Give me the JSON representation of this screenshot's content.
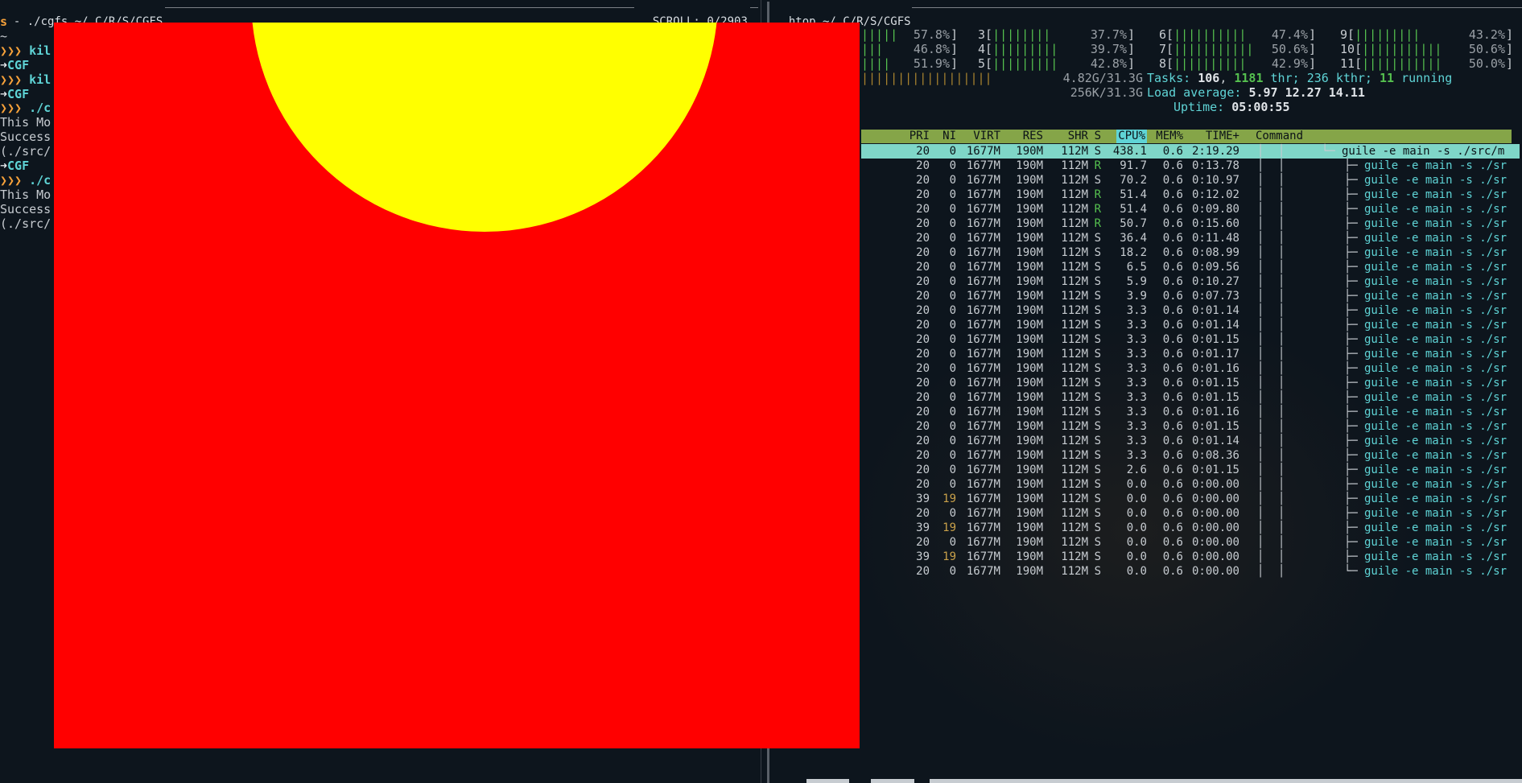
{
  "left_title": {
    "path": "./cgfs ~/.C/R/S/CGFS",
    "scroll_label": "SCROLL:",
    "scroll_value": "0/2903"
  },
  "right_title": {
    "path": "htop ~/.C/R/S/CGFS"
  },
  "terminal_lines": [
    {
      "kind": "s",
      "text": "s"
    },
    {
      "kind": "blank",
      "text": "~"
    },
    {
      "kind": "cmd",
      "prompt": "❯❯❯",
      "text": "kil"
    },
    {
      "kind": "git",
      "prompt": "➜",
      "text": "CGF"
    },
    {
      "kind": "cmd",
      "prompt": "❯❯❯",
      "text": "kil"
    },
    {
      "kind": "git",
      "prompt": "➜",
      "text": "CGF"
    },
    {
      "kind": "cmd",
      "prompt": "❯❯❯",
      "text": "./c"
    },
    {
      "kind": "out",
      "text": "This Mo"
    },
    {
      "kind": "out",
      "text": "Success"
    },
    {
      "kind": "out",
      "text": "(./src/"
    },
    {
      "kind": "git",
      "prompt": "➜",
      "text": "CGF"
    },
    {
      "kind": "cmd",
      "prompt": "❯❯❯",
      "text": "./c"
    },
    {
      "kind": "out",
      "text": "This Mo"
    },
    {
      "kind": "out",
      "text": "Success"
    },
    {
      "kind": "out",
      "text": "(./src/"
    }
  ],
  "cpu_meters": [
    {
      "col": 0,
      "row": 0,
      "label": "",
      "bar": "|||||",
      "value": "57.8%"
    },
    {
      "col": 0,
      "row": 1,
      "label": "",
      "bar": "|||",
      "value": "46.8%"
    },
    {
      "col": 0,
      "row": 2,
      "label": "",
      "bar": "||||",
      "value": "51.9%"
    },
    {
      "col": 1,
      "row": 0,
      "label": "3",
      "bar": "||||||||",
      "value": "37.7%"
    },
    {
      "col": 1,
      "row": 1,
      "label": "4",
      "bar": "|||||||||",
      "value": "39.7%"
    },
    {
      "col": 1,
      "row": 2,
      "label": "5",
      "bar": "|||||||||",
      "value": "42.8%"
    },
    {
      "col": 2,
      "row": 0,
      "label": "6",
      "bar": "||||||||||",
      "value": "47.4%"
    },
    {
      "col": 2,
      "row": 1,
      "label": "7",
      "bar": "|||||||||||",
      "value": "50.6%"
    },
    {
      "col": 2,
      "row": 2,
      "label": "8",
      "bar": "||||||||||",
      "value": "42.9%"
    },
    {
      "col": 3,
      "row": 0,
      "label": "9",
      "bar": "|||||||||",
      "value": "43.2%"
    },
    {
      "col": 3,
      "row": 1,
      "label": "10",
      "bar": "|||||||||||",
      "value": "50.6%"
    },
    {
      "col": 3,
      "row": 2,
      "label": "11",
      "bar": "|||||||||||",
      "value": "50.0%"
    }
  ],
  "mem": {
    "bar": "||||||||||||||||||",
    "value": "4.82G/31.3G"
  },
  "swap": {
    "value": "256K/31.3G"
  },
  "tasks": {
    "label": "Tasks:",
    "count": "106",
    "thr": "1181",
    "thr_label": "thr;",
    "kthr": "236",
    "kthr_label": "kthr;",
    "running": "11",
    "running_label": "running"
  },
  "load": {
    "label": "Load average:",
    "v1": "5.97",
    "v5": "12.27",
    "v15": "14.11"
  },
  "uptime": {
    "label": "Uptime:",
    "value": "05:00:55"
  },
  "columns": [
    "PRI",
    "NI",
    "VIRT",
    "RES",
    "SHR",
    "S",
    "CPU%",
    "MEM%",
    "TIME+",
    "Command"
  ],
  "processes": [
    {
      "pri": "20",
      "ni": "0",
      "virt": "1677M",
      "res": "190M",
      "shr": "112M",
      "s": "S",
      "cpu": "438.1",
      "mem": "0.6",
      "time": "2:19.29",
      "tree": "└─",
      "cmd": "guile -e main -s ./src/m"
    },
    {
      "pri": "20",
      "ni": "0",
      "virt": "1677M",
      "res": "190M",
      "shr": "112M",
      "s": "R",
      "cpu": "91.7",
      "mem": "0.6",
      "time": "0:13.78",
      "tree": "├─",
      "cmd": "guile -e main -s ./sr"
    },
    {
      "pri": "20",
      "ni": "0",
      "virt": "1677M",
      "res": "190M",
      "shr": "112M",
      "s": "S",
      "cpu": "70.2",
      "mem": "0.6",
      "time": "0:10.97",
      "tree": "├─",
      "cmd": "guile -e main -s ./sr"
    },
    {
      "pri": "20",
      "ni": "0",
      "virt": "1677M",
      "res": "190M",
      "shr": "112M",
      "s": "R",
      "cpu": "51.4",
      "mem": "0.6",
      "time": "0:12.02",
      "tree": "├─",
      "cmd": "guile -e main -s ./sr"
    },
    {
      "pri": "20",
      "ni": "0",
      "virt": "1677M",
      "res": "190M",
      "shr": "112M",
      "s": "R",
      "cpu": "51.4",
      "mem": "0.6",
      "time": "0:09.80",
      "tree": "├─",
      "cmd": "guile -e main -s ./sr"
    },
    {
      "pri": "20",
      "ni": "0",
      "virt": "1677M",
      "res": "190M",
      "shr": "112M",
      "s": "R",
      "cpu": "50.7",
      "mem": "0.6",
      "time": "0:15.60",
      "tree": "├─",
      "cmd": "guile -e main -s ./sr"
    },
    {
      "pri": "20",
      "ni": "0",
      "virt": "1677M",
      "res": "190M",
      "shr": "112M",
      "s": "S",
      "cpu": "36.4",
      "mem": "0.6",
      "time": "0:11.48",
      "tree": "├─",
      "cmd": "guile -e main -s ./sr"
    },
    {
      "pri": "20",
      "ni": "0",
      "virt": "1677M",
      "res": "190M",
      "shr": "112M",
      "s": "S",
      "cpu": "18.2",
      "mem": "0.6",
      "time": "0:08.99",
      "tree": "├─",
      "cmd": "guile -e main -s ./sr"
    },
    {
      "pri": "20",
      "ni": "0",
      "virt": "1677M",
      "res": "190M",
      "shr": "112M",
      "s": "S",
      "cpu": "6.5",
      "mem": "0.6",
      "time": "0:09.56",
      "tree": "├─",
      "cmd": "guile -e main -s ./sr"
    },
    {
      "pri": "20",
      "ni": "0",
      "virt": "1677M",
      "res": "190M",
      "shr": "112M",
      "s": "S",
      "cpu": "5.9",
      "mem": "0.6",
      "time": "0:10.27",
      "tree": "├─",
      "cmd": "guile -e main -s ./sr"
    },
    {
      "pri": "20",
      "ni": "0",
      "virt": "1677M",
      "res": "190M",
      "shr": "112M",
      "s": "S",
      "cpu": "3.9",
      "mem": "0.6",
      "time": "0:07.73",
      "tree": "├─",
      "cmd": "guile -e main -s ./sr"
    },
    {
      "pri": "20",
      "ni": "0",
      "virt": "1677M",
      "res": "190M",
      "shr": "112M",
      "s": "S",
      "cpu": "3.3",
      "mem": "0.6",
      "time": "0:01.14",
      "tree": "├─",
      "cmd": "guile -e main -s ./sr"
    },
    {
      "pri": "20",
      "ni": "0",
      "virt": "1677M",
      "res": "190M",
      "shr": "112M",
      "s": "S",
      "cpu": "3.3",
      "mem": "0.6",
      "time": "0:01.14",
      "tree": "├─",
      "cmd": "guile -e main -s ./sr"
    },
    {
      "pri": "20",
      "ni": "0",
      "virt": "1677M",
      "res": "190M",
      "shr": "112M",
      "s": "S",
      "cpu": "3.3",
      "mem": "0.6",
      "time": "0:01.15",
      "tree": "├─",
      "cmd": "guile -e main -s ./sr"
    },
    {
      "pri": "20",
      "ni": "0",
      "virt": "1677M",
      "res": "190M",
      "shr": "112M",
      "s": "S",
      "cpu": "3.3",
      "mem": "0.6",
      "time": "0:01.17",
      "tree": "├─",
      "cmd": "guile -e main -s ./sr"
    },
    {
      "pri": "20",
      "ni": "0",
      "virt": "1677M",
      "res": "190M",
      "shr": "112M",
      "s": "S",
      "cpu": "3.3",
      "mem": "0.6",
      "time": "0:01.16",
      "tree": "├─",
      "cmd": "guile -e main -s ./sr"
    },
    {
      "pri": "20",
      "ni": "0",
      "virt": "1677M",
      "res": "190M",
      "shr": "112M",
      "s": "S",
      "cpu": "3.3",
      "mem": "0.6",
      "time": "0:01.15",
      "tree": "├─",
      "cmd": "guile -e main -s ./sr"
    },
    {
      "pri": "20",
      "ni": "0",
      "virt": "1677M",
      "res": "190M",
      "shr": "112M",
      "s": "S",
      "cpu": "3.3",
      "mem": "0.6",
      "time": "0:01.15",
      "tree": "├─",
      "cmd": "guile -e main -s ./sr"
    },
    {
      "pri": "20",
      "ni": "0",
      "virt": "1677M",
      "res": "190M",
      "shr": "112M",
      "s": "S",
      "cpu": "3.3",
      "mem": "0.6",
      "time": "0:01.16",
      "tree": "├─",
      "cmd": "guile -e main -s ./sr"
    },
    {
      "pri": "20",
      "ni": "0",
      "virt": "1677M",
      "res": "190M",
      "shr": "112M",
      "s": "S",
      "cpu": "3.3",
      "mem": "0.6",
      "time": "0:01.15",
      "tree": "├─",
      "cmd": "guile -e main -s ./sr"
    },
    {
      "pri": "20",
      "ni": "0",
      "virt": "1677M",
      "res": "190M",
      "shr": "112M",
      "s": "S",
      "cpu": "3.3",
      "mem": "0.6",
      "time": "0:01.14",
      "tree": "├─",
      "cmd": "guile -e main -s ./sr"
    },
    {
      "pri": "20",
      "ni": "0",
      "virt": "1677M",
      "res": "190M",
      "shr": "112M",
      "s": "S",
      "cpu": "3.3",
      "mem": "0.6",
      "time": "0:08.36",
      "tree": "├─",
      "cmd": "guile -e main -s ./sr"
    },
    {
      "pri": "20",
      "ni": "0",
      "virt": "1677M",
      "res": "190M",
      "shr": "112M",
      "s": "S",
      "cpu": "2.6",
      "mem": "0.6",
      "time": "0:01.15",
      "tree": "├─",
      "cmd": "guile -e main -s ./sr"
    },
    {
      "pri": "20",
      "ni": "0",
      "virt": "1677M",
      "res": "190M",
      "shr": "112M",
      "s": "S",
      "cpu": "0.0",
      "mem": "0.6",
      "time": "0:00.00",
      "tree": "├─",
      "cmd": "guile -e main -s ./sr"
    },
    {
      "pri": "39",
      "ni": "19",
      "virt": "1677M",
      "res": "190M",
      "shr": "112M",
      "s": "S",
      "cpu": "0.0",
      "mem": "0.6",
      "time": "0:00.00",
      "tree": "├─",
      "cmd": "guile -e main -s ./sr"
    },
    {
      "pri": "20",
      "ni": "0",
      "virt": "1677M",
      "res": "190M",
      "shr": "112M",
      "s": "S",
      "cpu": "0.0",
      "mem": "0.6",
      "time": "0:00.00",
      "tree": "├─",
      "cmd": "guile -e main -s ./sr"
    },
    {
      "pri": "39",
      "ni": "19",
      "virt": "1677M",
      "res": "190M",
      "shr": "112M",
      "s": "S",
      "cpu": "0.0",
      "mem": "0.6",
      "time": "0:00.00",
      "tree": "├─",
      "cmd": "guile -e main -s ./sr"
    },
    {
      "pri": "20",
      "ni": "0",
      "virt": "1677M",
      "res": "190M",
      "shr": "112M",
      "s": "S",
      "cpu": "0.0",
      "mem": "0.6",
      "time": "0:00.00",
      "tree": "├─",
      "cmd": "guile -e main -s ./sr"
    },
    {
      "pri": "39",
      "ni": "19",
      "virt": "1677M",
      "res": "190M",
      "shr": "112M",
      "s": "S",
      "cpu": "0.0",
      "mem": "0.6",
      "time": "0:00.00",
      "tree": "├─",
      "cmd": "guile -e main -s ./sr"
    },
    {
      "pri": "20",
      "ni": "0",
      "virt": "1677M",
      "res": "190M",
      "shr": "112M",
      "s": "S",
      "cpu": "0.0",
      "mem": "0.6",
      "time": "0:00.00",
      "tree": "└─",
      "cmd": "guile -e main -s ./sr"
    }
  ],
  "colors": {
    "sdl_background": "#ff0000",
    "sdl_circle": "#ffff00",
    "header_bar": "#85a548",
    "selected_row": "#7fd6c8"
  }
}
